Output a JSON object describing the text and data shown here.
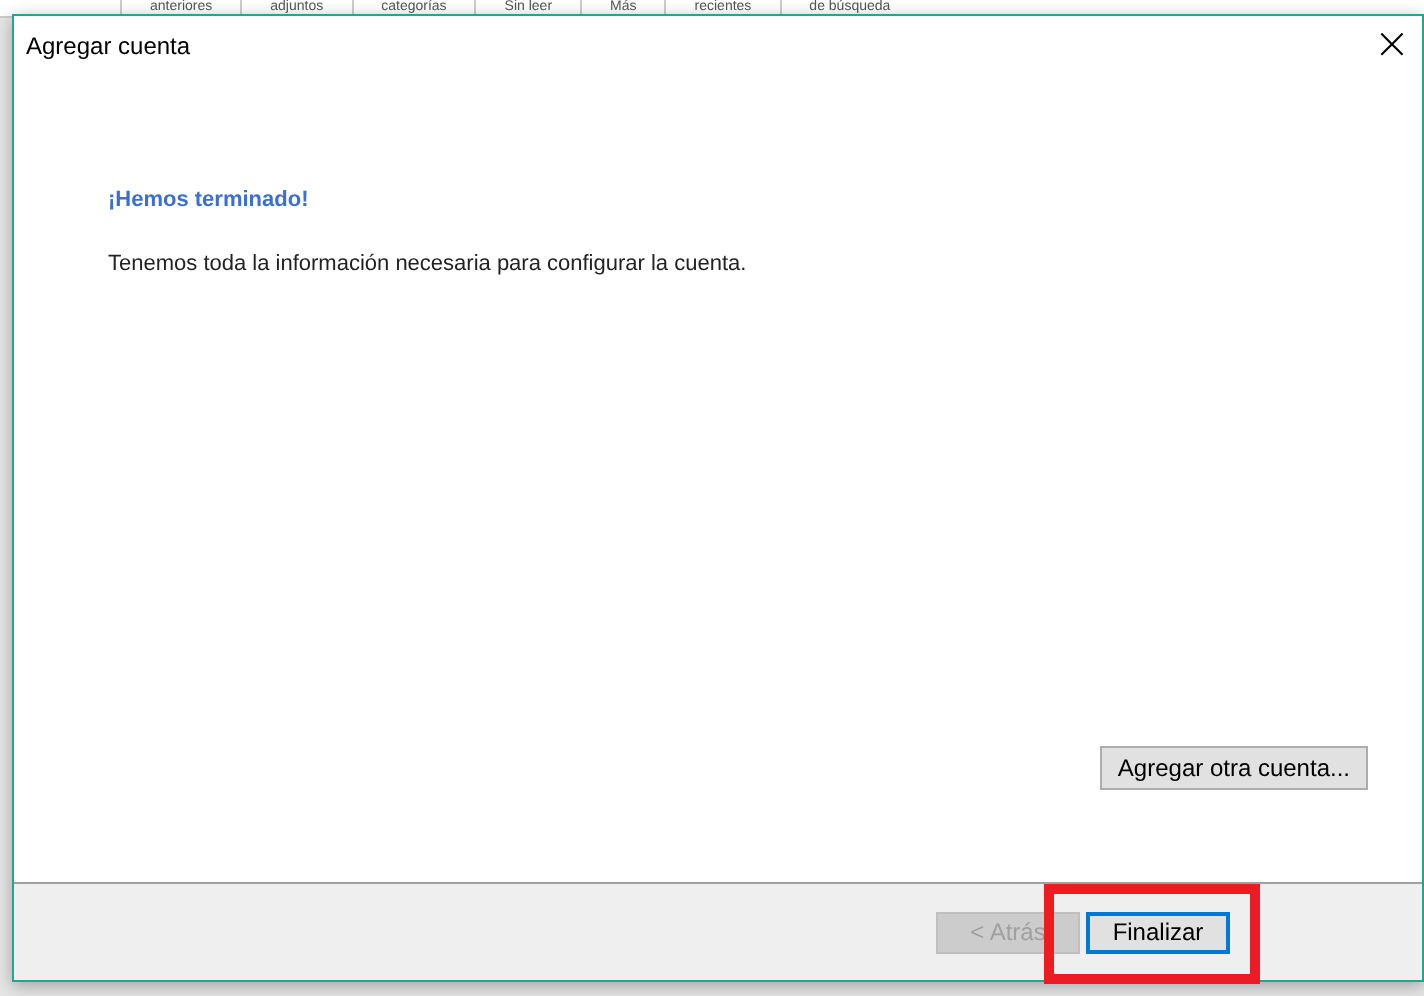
{
  "background_ribbon": {
    "labels": [
      "anteriores",
      "adjuntos",
      "categorías",
      "Sin leer",
      "Más",
      "recientes",
      "de búsqueda"
    ]
  },
  "window": {
    "title": "Agregar cuenta",
    "close": "×"
  },
  "content": {
    "heading": "¡Hemos terminado!",
    "message": "Tenemos toda la información necesaria para configurar la cuenta.",
    "add_another_button": "Agregar otra cuenta..."
  },
  "footer": {
    "buttons": [
      {
        "label": "< Atrás",
        "disabled": true,
        "default": false,
        "highlighted": false
      },
      {
        "label": "Finalizar",
        "disabled": false,
        "default": true,
        "highlighted": true
      }
    ]
  }
}
